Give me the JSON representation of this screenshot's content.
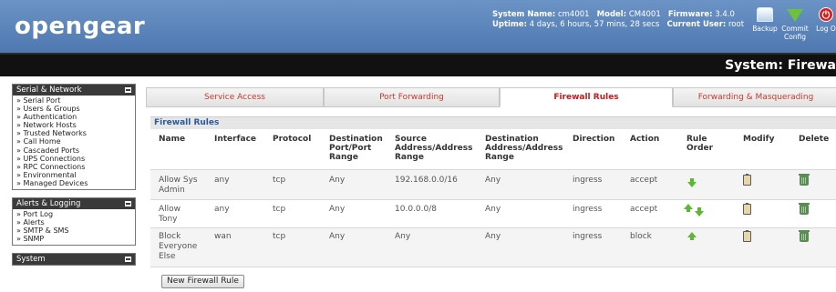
{
  "header": {
    "logo": "opengear",
    "system_name_label": "System Name:",
    "system_name": "cm4001",
    "model_label": "Model:",
    "model": "CM4001",
    "firmware_label": "Firmware:",
    "firmware": "3.4.0",
    "uptime_label": "Uptime:",
    "uptime": "4 days, 6 hours, 57 mins, 28 secs",
    "current_user_label": "Current User:",
    "current_user": "root",
    "backup_label": "Backup",
    "commit_label_1": "Commit",
    "commit_label_2": "Config",
    "logout_label": "Log O",
    "page_title": "System: Firewa"
  },
  "sidebar": {
    "sections": [
      {
        "title": "Serial & Network",
        "items": [
          "Serial Port",
          "Users & Groups",
          "Authentication",
          "Network Hosts",
          "Trusted Networks",
          "Call Home",
          "Cascaded Ports",
          "UPS Connections",
          "RPC Connections",
          "Environmental",
          "Managed Devices"
        ]
      },
      {
        "title": "Alerts & Logging",
        "items": [
          "Port Log",
          "Alerts",
          "SMTP & SMS",
          "SNMP"
        ]
      },
      {
        "title": "System",
        "items": []
      }
    ]
  },
  "tabs": [
    "Service Access",
    "Port Forwarding",
    "Firewall Rules",
    "Forwarding & Masquerading"
  ],
  "active_tab": "Firewall Rules",
  "table": {
    "title": "Firewall Rules",
    "headers": {
      "name": "Name",
      "interface": "Interface",
      "protocol": "Protocol",
      "dest_port_1": "Destination",
      "dest_port_2": "Port/Port",
      "dest_port_3": "Range",
      "source_1": "Source",
      "source_2": "Address/Address",
      "source_3": "Range",
      "dest_addr_1": "Destination",
      "dest_addr_2": "Address/Address",
      "dest_addr_3": "Range",
      "direction": "Direction",
      "action": "Action",
      "rule_order_1": "Rule",
      "rule_order_2": "Order",
      "modify": "Modify",
      "delete": "Delete"
    },
    "rows": [
      {
        "name_1": "Allow Sys",
        "name_2": "Admin",
        "name_3": "",
        "interface": "any",
        "protocol": "tcp",
        "dest_port": "Any",
        "source": "192.168.0.0/16",
        "dest_addr": "Any",
        "direction": "ingress",
        "action": "accept"
      },
      {
        "name_1": "Allow",
        "name_2": "Tony",
        "name_3": "",
        "interface": "any",
        "protocol": "tcp",
        "dest_port": "Any",
        "source": "10.0.0.0/8",
        "dest_addr": "Any",
        "direction": "ingress",
        "action": "accept"
      },
      {
        "name_1": "Block",
        "name_2": "Everyone",
        "name_3": "Else",
        "interface": "wan",
        "protocol": "tcp",
        "dest_port": "Any",
        "source": "Any",
        "dest_addr": "Any",
        "direction": "ingress",
        "action": "block"
      }
    ]
  },
  "new_rule_button": "New Firewall Rule",
  "icons": {
    "order_up": "arrow-up-icon",
    "order_down": "arrow-down-icon",
    "modify": "clipboard-icon",
    "delete": "trash-icon"
  },
  "colors": {
    "header_blue": "#5a84bb",
    "tab_text": "#c83a2a",
    "table_title": "#2a5a9b",
    "arrow_green": "#5cb832"
  }
}
